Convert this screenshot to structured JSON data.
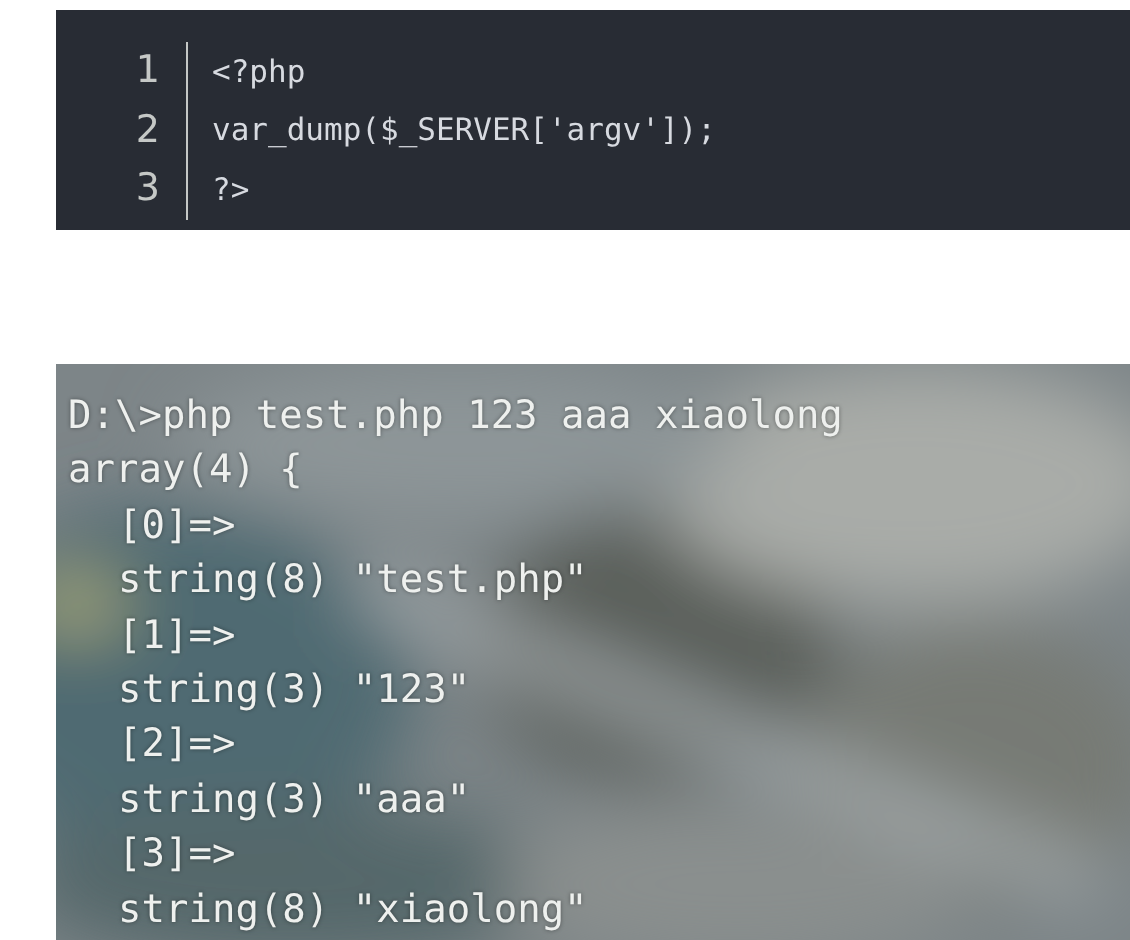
{
  "code_block": {
    "lines": [
      {
        "number": "1",
        "code": "<?php"
      },
      {
        "number": "2",
        "code": "var_dump($_SERVER['argv']);"
      },
      {
        "number": "3",
        "code": "?>"
      }
    ]
  },
  "console": {
    "kind": "picture",
    "lines": [
      {
        "text": "D:\\>php test.php 123 aaa xiaolong"
      },
      {
        "text": "array(4) {",
        "children": [
          {
            "text": "[0]=>"
          },
          {
            "text": "string(8) \"test.php\""
          },
          {
            "text": "[1]=>"
          },
          {
            "text": "string(3) \"123\""
          },
          {
            "text": "[2]=>"
          },
          {
            "text": "string(3) \"aaa\""
          },
          {
            "text": "[3]=>"
          },
          {
            "text": "string(8) \"xiaolong\""
          }
        ]
      }
    ]
  }
}
